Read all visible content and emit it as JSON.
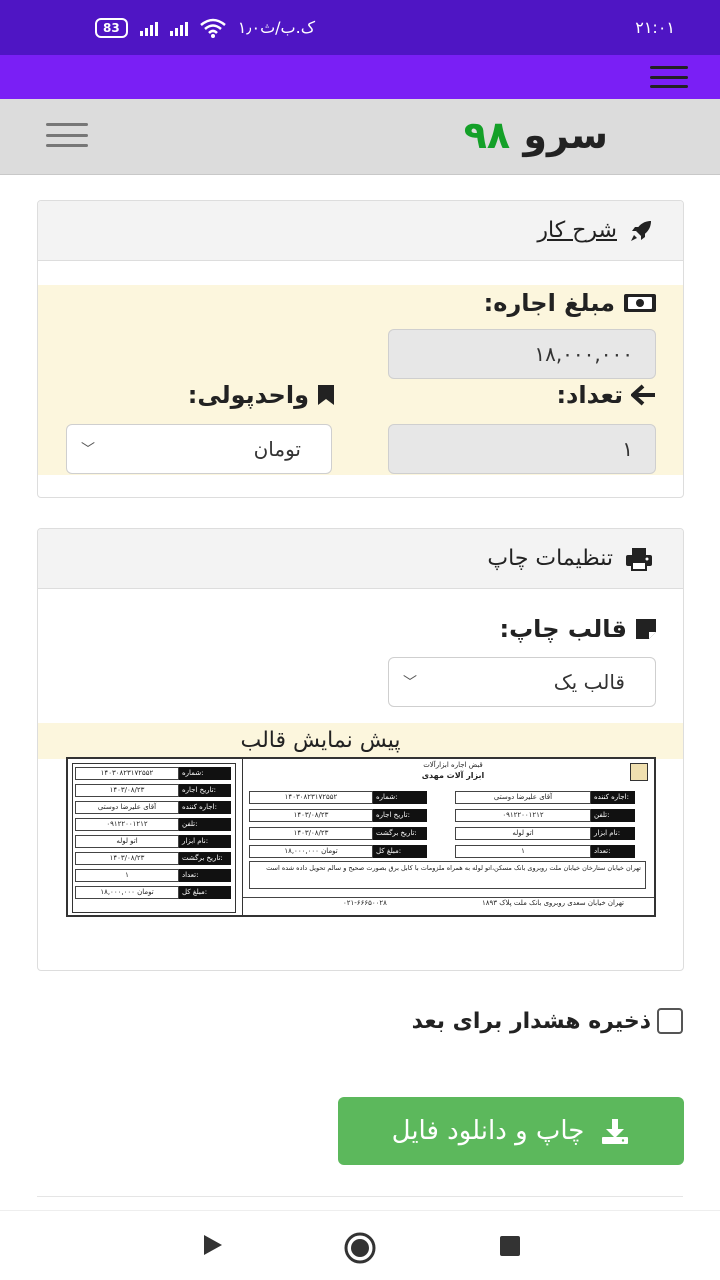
{
  "statusbar": {
    "time": "۲۱:۰۱",
    "speed": "۱٫۰ک.ب/ث",
    "battery": "83"
  },
  "header": {
    "brand_word": "سرو",
    "brand_num": "۹۸"
  },
  "job_panel": {
    "title": "شرح کار",
    "rent_label": "مبلغ اجاره:",
    "rent_value": "۱۸,۰۰۰,۰۰۰",
    "count_label": "تعداد:",
    "count_value": "۱",
    "currency_label": "واحدپولی:",
    "currency_value": "تومان"
  },
  "print_panel": {
    "title": "تنظیمات چاپ",
    "template_label": "قالب چاپ:",
    "template_value": "قالب یک",
    "preview_title": "پیش نمایش قالب"
  },
  "receipt": {
    "header_small": "قبض اجاره ابزارآلات",
    "header_big": "ابزار آلات مهدی",
    "rows_right": [
      {
        "label": "اجاره کننده:",
        "value": "آقای علیرضا دوستی"
      },
      {
        "label": "تلفن:",
        "value": "۰۹۱۲۲۰۰۱۲۱۲"
      },
      {
        "label": "نام ابزار:",
        "value": "اتو لوله"
      },
      {
        "label": "تعداد:",
        "value": "۱"
      }
    ],
    "rows_mid": [
      {
        "label": "شماره:",
        "value": "۱۴۰۳۰۸۲۳۱۷۲۵۵۲"
      },
      {
        "label": "تاریخ اجاره:",
        "value": "۱۴۰۳/۰۸/۲۳"
      },
      {
        "label": "تاریخ برگشت:",
        "value": "۱۴۰۳/۰۸/۲۳"
      },
      {
        "label": "مبلغ کل:",
        "value": "۱۸,۰۰۰,۰۰۰ تومان"
      }
    ],
    "note": "تهران خیابان ستارخان خیابان ملت روبروی بانک مسکن،اتو لوله به همراه ملزومات با کابل برق بصورت صحیح و سالم تحویل داده شده است",
    "footer_address": "تهران خیابان سعدی روبروی بانک ملت پلاک ۱۸۹۳",
    "footer_phone": "۰۲۱-۶۶۶۵۰۰۲۸",
    "left_rows": [
      {
        "label": "شماره:",
        "value": "۱۴۰۳۰۸۲۳۱۷۲۵۵۲"
      },
      {
        "label": "تاریخ اجاره:",
        "value": "۱۴۰۳/۰۸/۲۳"
      },
      {
        "label": "اجاره کننده:",
        "value": "آقای علیرضا دوستی"
      },
      {
        "label": "تلفن:",
        "value": "۰۹۱۲۲۰۰۱۲۱۲"
      },
      {
        "label": "نام ابزار:",
        "value": "اتو لوله"
      },
      {
        "label": "تاریخ برگشت:",
        "value": "۱۴۰۳/۰۸/۲۳"
      },
      {
        "label": "تعداد:",
        "value": "۱"
      },
      {
        "label": "مبلغ کل:",
        "value": "۱۸,۰۰۰,۰۰۰ تومان"
      }
    ]
  },
  "save_warning_label": "ذخیره هشدار برای بعد",
  "download_button": "چاپ و دانلود فایل",
  "colors": {
    "status_bar": "#4f15c4",
    "accent_bar": "#7a1ff5",
    "brand_green": "#14a028",
    "button_green": "#5cb85c",
    "cream": "#fcf6dd"
  }
}
